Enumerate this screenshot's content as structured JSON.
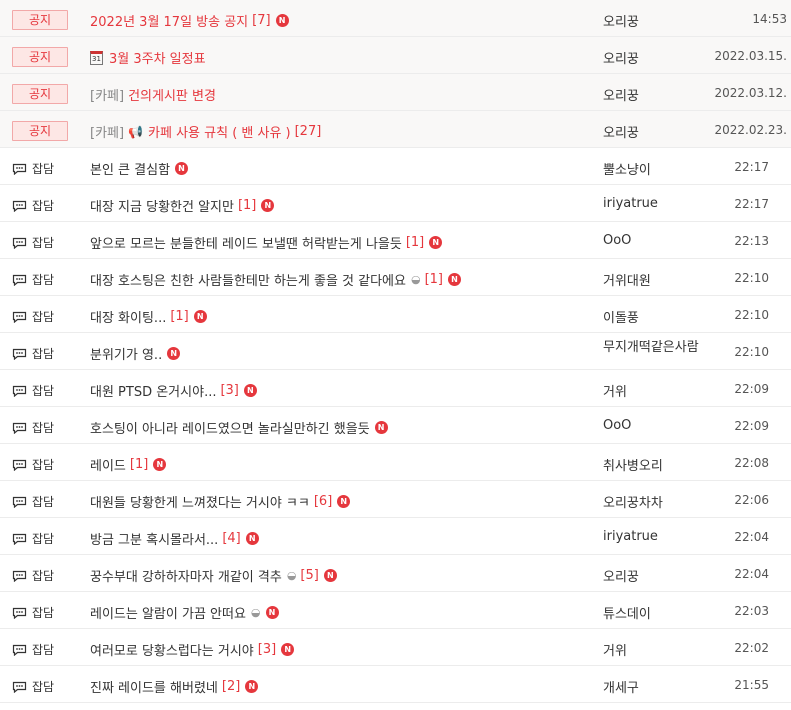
{
  "notices": [
    {
      "badge": "공지",
      "prefix": "",
      "icon": "",
      "title": "2022년 3월 17일 방송 공지",
      "count": "[7]",
      "new": "N",
      "author": "오리꿍",
      "date": "14:53"
    },
    {
      "badge": "공지",
      "prefix": "",
      "icon": "calendar-icon",
      "icon_text": "31",
      "title": "3월 3주차 일정표",
      "count": "",
      "new": "",
      "author": "오리꿍",
      "date": "2022.03.15."
    },
    {
      "badge": "공지",
      "prefix": "[카페]",
      "icon": "",
      "title": "건의게시판 변경",
      "count": "",
      "new": "",
      "author": "오리꿍",
      "date": "2022.03.12."
    },
    {
      "badge": "공지",
      "prefix": "[카페]",
      "icon": "megaphone-icon",
      "icon_text": "📢",
      "title": "카페 사용 규칙 ( 밴 사유 )",
      "count": "[27]",
      "new": "",
      "author": "오리꿍",
      "date": "2022.02.23."
    }
  ],
  "posts": [
    {
      "category": "잡담",
      "title": "본인 큰 결심함",
      "count": "",
      "emoji": "",
      "new": "N",
      "author": "뿔소냥이",
      "date": "22:17"
    },
    {
      "category": "잡담",
      "title": "대장 지금 당황한건 알지만",
      "count": "[1]",
      "emoji": "",
      "new": "N",
      "author": "iriyatrue",
      "date": "22:17"
    },
    {
      "category": "잡담",
      "title": "앞으로 모르는 분들한테 레이드 보낼땐 허락받는게 나을듯",
      "count": "[1]",
      "emoji": "",
      "new": "N",
      "author": "OoO",
      "date": "22:13"
    },
    {
      "category": "잡담",
      "title": "대장 호스팅은 친한 사람들한테만 하는게 좋을 것 같다에요",
      "count": "[1]",
      "emoji": "◒",
      "new": "N",
      "author": "거위대원",
      "date": "22:10"
    },
    {
      "category": "잡담",
      "title": "대장 화이팅...",
      "count": "[1]",
      "emoji": "",
      "new": "N",
      "author": "이돌풍",
      "date": "22:10"
    },
    {
      "category": "잡담",
      "title": "분위기가 영..",
      "count": "",
      "emoji": "",
      "new": "N",
      "author": "무지개떡같은사람",
      "date": "22:10"
    },
    {
      "category": "잡담",
      "title": "대원 PTSD 온거시야...",
      "count": "[3]",
      "emoji": "",
      "new": "N",
      "author": "거위",
      "date": "22:09"
    },
    {
      "category": "잡담",
      "title": "호스팅이 아니라 레이드였으면 놀라실만하긴 했을듯",
      "count": "",
      "emoji": "",
      "new": "N",
      "author": "OoO",
      "date": "22:09"
    },
    {
      "category": "잡담",
      "title": "레이드",
      "count": "[1]",
      "emoji": "",
      "new": "N",
      "author": "취사병오리",
      "date": "22:08"
    },
    {
      "category": "잡담",
      "title": "대원들 당황한게 느껴졌다는 거시야 ㅋㅋ",
      "count": "[6]",
      "emoji": "",
      "new": "N",
      "author": "오리꿍차차",
      "date": "22:06"
    },
    {
      "category": "잡담",
      "title": "방금 그분 혹시몰라서...",
      "count": "[4]",
      "emoji": "",
      "new": "N",
      "author": "iriyatrue",
      "date": "22:04"
    },
    {
      "category": "잡담",
      "title": "꿍수부대 강하하자마자 개같이 격추",
      "count": "[5]",
      "emoji": "◒",
      "new": "N",
      "author": "오리꿍",
      "date": "22:04"
    },
    {
      "category": "잡담",
      "title": "레이드는 알람이 가끔 안떠요",
      "count": "",
      "emoji": "◒",
      "new": "N",
      "author": "튜스데이",
      "date": "22:03"
    },
    {
      "category": "잡담",
      "title": "여러모로 당황스럽다는 거시야",
      "count": "[3]",
      "emoji": "",
      "new": "N",
      "author": "거위",
      "date": "22:02"
    },
    {
      "category": "잡담",
      "title": "진짜 레이드를 해버렸네",
      "count": "[2]",
      "emoji": "",
      "new": "N",
      "author": "개세구",
      "date": "21:55"
    }
  ]
}
